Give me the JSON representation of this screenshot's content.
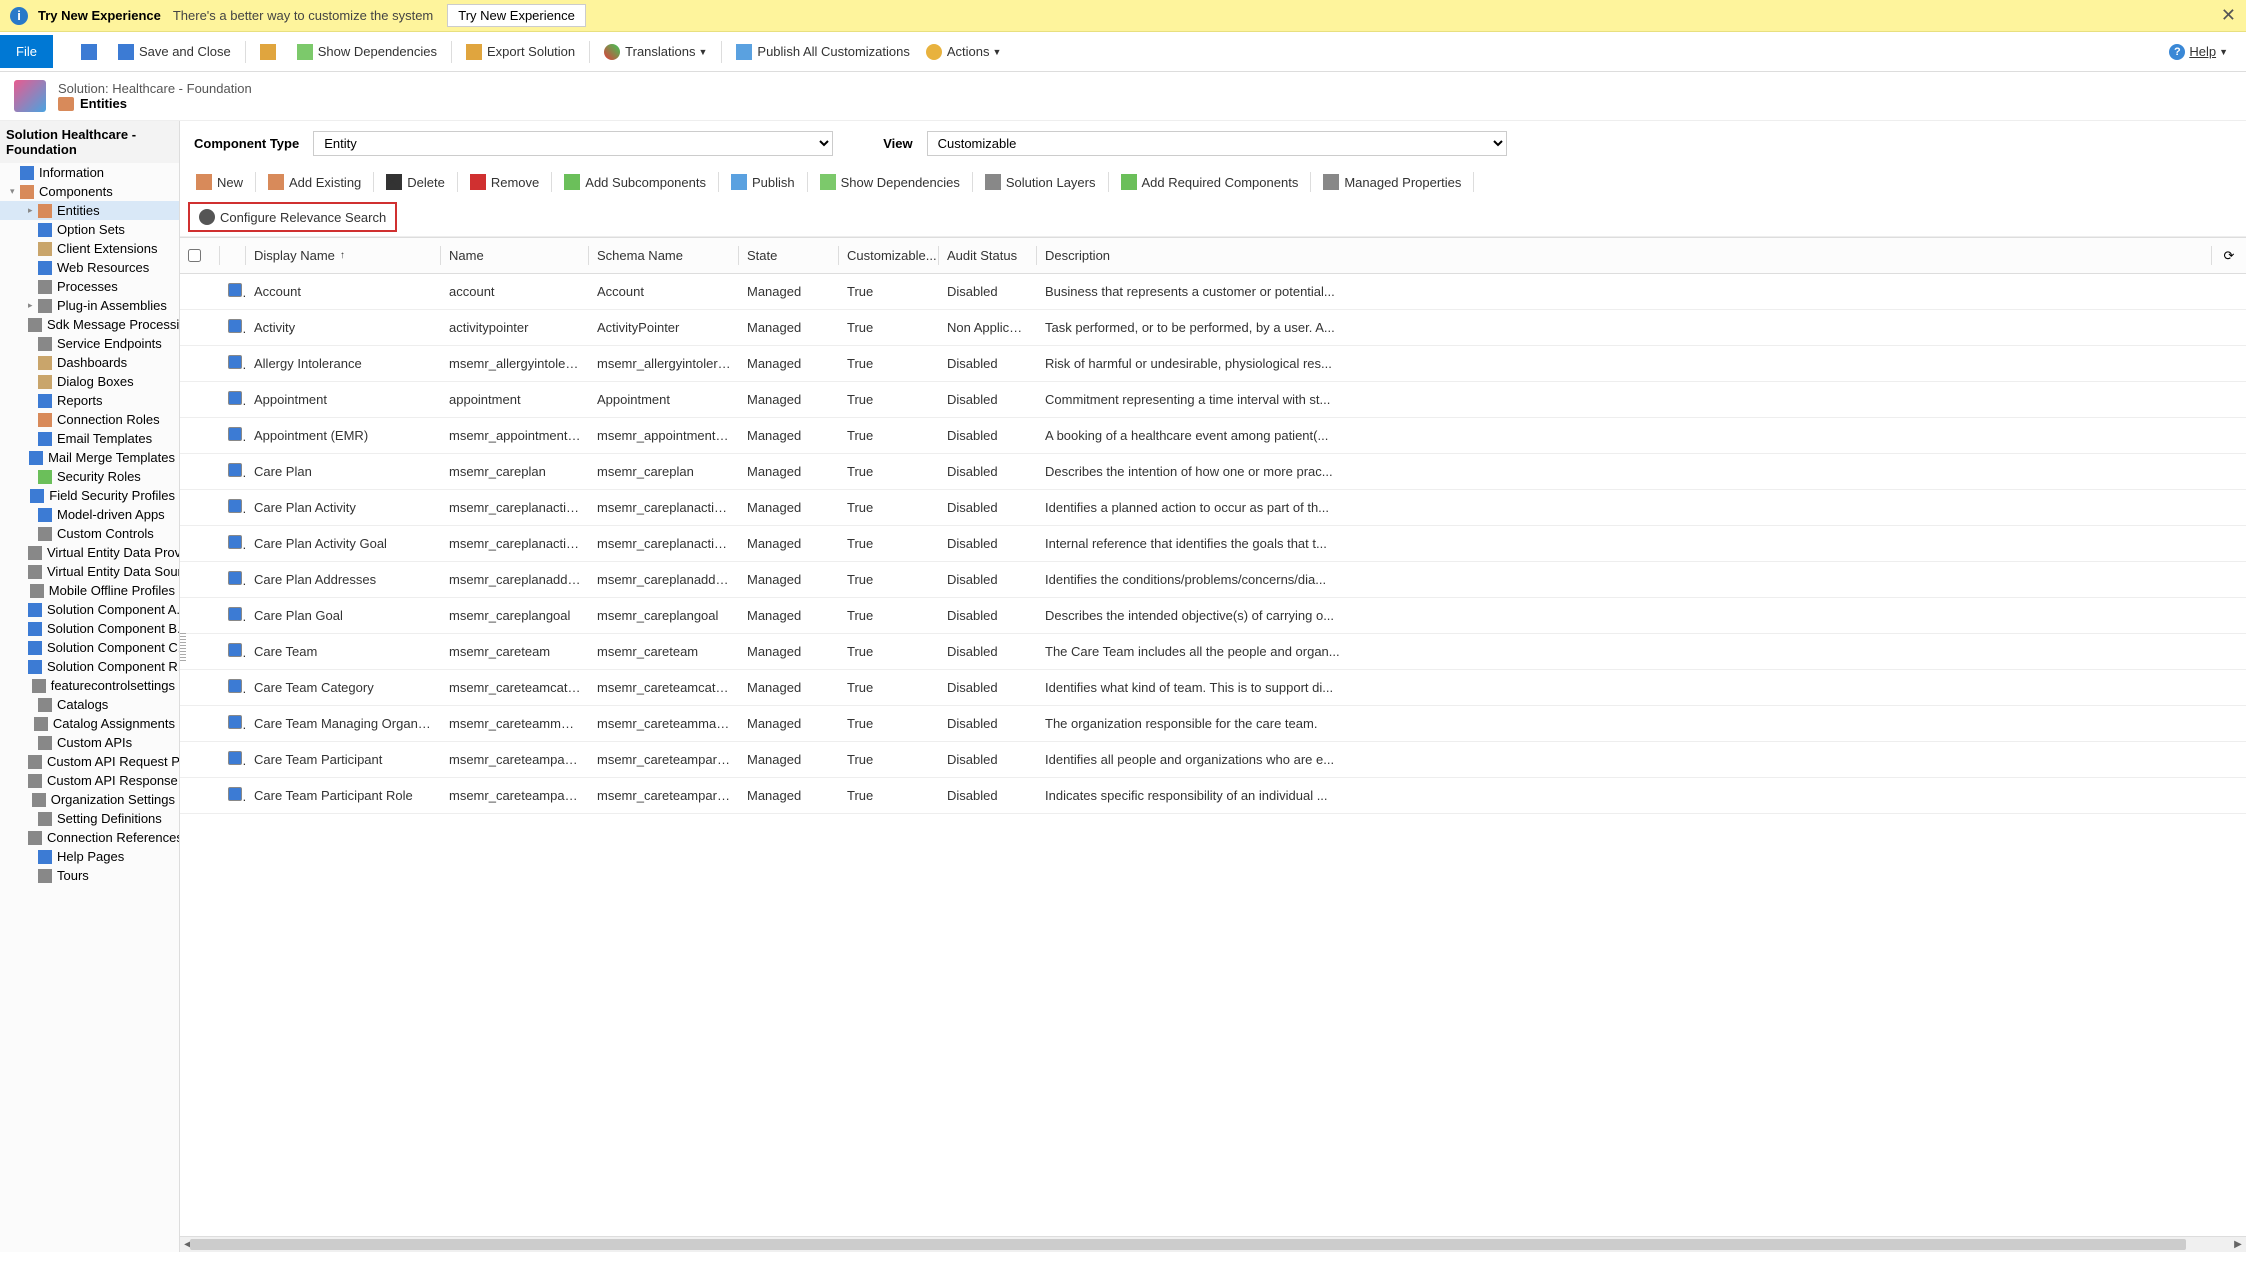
{
  "banner": {
    "title": "Try New Experience",
    "subtitle": "There's a better way to customize the system",
    "button": "Try New Experience"
  },
  "ribbon": {
    "file": "File",
    "save_close": "Save and Close",
    "show_deps": "Show Dependencies",
    "export": "Export Solution",
    "translations": "Translations",
    "publish_all": "Publish All Customizations",
    "actions": "Actions",
    "help": "Help"
  },
  "header": {
    "breadcrumb": "Solution: Healthcare - Foundation",
    "title": "Entities"
  },
  "sidebar": {
    "title": "Solution Healthcare - Foundation",
    "items": [
      {
        "label": "Information",
        "cls": "sic-blue",
        "lvl": 1
      },
      {
        "label": "Components",
        "cls": "sic-orange",
        "lvl": 1,
        "tw": "▾"
      },
      {
        "label": "Entities",
        "cls": "sic-orange",
        "lvl": 2,
        "tw": "▸",
        "sel": true
      },
      {
        "label": "Option Sets",
        "cls": "sic-blue",
        "lvl": 2
      },
      {
        "label": "Client Extensions",
        "cls": "sic-tan",
        "lvl": 2
      },
      {
        "label": "Web Resources",
        "cls": "sic-blue",
        "lvl": 2
      },
      {
        "label": "Processes",
        "cls": "sic-gray",
        "lvl": 2
      },
      {
        "label": "Plug-in Assemblies",
        "cls": "sic-gray",
        "lvl": 2,
        "tw": "▸"
      },
      {
        "label": "Sdk Message Processin...",
        "cls": "sic-gray",
        "lvl": 2
      },
      {
        "label": "Service Endpoints",
        "cls": "sic-gray",
        "lvl": 2
      },
      {
        "label": "Dashboards",
        "cls": "sic-tan",
        "lvl": 2
      },
      {
        "label": "Dialog Boxes",
        "cls": "sic-tan",
        "lvl": 2
      },
      {
        "label": "Reports",
        "cls": "sic-blue",
        "lvl": 2
      },
      {
        "label": "Connection Roles",
        "cls": "sic-orange",
        "lvl": 2
      },
      {
        "label": "Email Templates",
        "cls": "sic-blue",
        "lvl": 2
      },
      {
        "label": "Mail Merge Templates",
        "cls": "sic-blue",
        "lvl": 2
      },
      {
        "label": "Security Roles",
        "cls": "sic-green",
        "lvl": 2
      },
      {
        "label": "Field Security Profiles",
        "cls": "sic-blue",
        "lvl": 2
      },
      {
        "label": "Model-driven Apps",
        "cls": "sic-blue",
        "lvl": 2
      },
      {
        "label": "Custom Controls",
        "cls": "sic-gray",
        "lvl": 2
      },
      {
        "label": "Virtual Entity Data Prov...",
        "cls": "sic-gray",
        "lvl": 2
      },
      {
        "label": "Virtual Entity Data Sour...",
        "cls": "sic-gray",
        "lvl": 2
      },
      {
        "label": "Mobile Offline Profiles",
        "cls": "sic-gray",
        "lvl": 2
      },
      {
        "label": "Solution Component A...",
        "cls": "sic-blue",
        "lvl": 2
      },
      {
        "label": "Solution Component B...",
        "cls": "sic-blue",
        "lvl": 2
      },
      {
        "label": "Solution Component C...",
        "cls": "sic-blue",
        "lvl": 2
      },
      {
        "label": "Solution Component R...",
        "cls": "sic-blue",
        "lvl": 2
      },
      {
        "label": "featurecontrolsettings",
        "cls": "sic-gray",
        "lvl": 2
      },
      {
        "label": "Catalogs",
        "cls": "sic-gray",
        "lvl": 2
      },
      {
        "label": "Catalog Assignments",
        "cls": "sic-gray",
        "lvl": 2
      },
      {
        "label": "Custom APIs",
        "cls": "sic-gray",
        "lvl": 2
      },
      {
        "label": "Custom API Request Pa...",
        "cls": "sic-gray",
        "lvl": 2
      },
      {
        "label": "Custom API Response ...",
        "cls": "sic-gray",
        "lvl": 2
      },
      {
        "label": "Organization Settings",
        "cls": "sic-gray",
        "lvl": 2
      },
      {
        "label": "Setting Definitions",
        "cls": "sic-gray",
        "lvl": 2
      },
      {
        "label": "Connection References",
        "cls": "sic-gray",
        "lvl": 2
      },
      {
        "label": "Help Pages",
        "cls": "sic-blue",
        "lvl": 2
      },
      {
        "label": "Tours",
        "cls": "sic-gray",
        "lvl": 2
      }
    ]
  },
  "filters": {
    "comp_type_label": "Component Type",
    "comp_type_value": "Entity",
    "view_label": "View",
    "view_value": "Customizable"
  },
  "toolbar2": {
    "new_": "New",
    "add_existing": "Add Existing",
    "delete_": "Delete",
    "remove": "Remove",
    "add_sub": "Add Subcomponents",
    "publish": "Publish",
    "show_deps": "Show Dependencies",
    "layers": "Solution Layers",
    "add_req": "Add Required Components",
    "mprops": "Managed Properties",
    "config_search": "Configure Relevance Search"
  },
  "grid": {
    "headers": {
      "disp": "Display Name",
      "name": "Name",
      "schema": "Schema Name",
      "state": "State",
      "cust": "Customizable...",
      "audit": "Audit Status",
      "desc": "Description"
    },
    "rows": [
      {
        "disp": "Account",
        "name": "account",
        "schema": "Account",
        "state": "Managed",
        "cust": "True",
        "audit": "Disabled",
        "desc": "Business that represents a customer or potential..."
      },
      {
        "disp": "Activity",
        "name": "activitypointer",
        "schema": "ActivityPointer",
        "state": "Managed",
        "cust": "True",
        "audit": "Non Applicable",
        "desc": "Task performed, or to be performed, by a user. A..."
      },
      {
        "disp": "Allergy Intolerance",
        "name": "msemr_allergyintolera...",
        "schema": "msemr_allergyintolera...",
        "state": "Managed",
        "cust": "True",
        "audit": "Disabled",
        "desc": "Risk of harmful or undesirable, physiological res..."
      },
      {
        "disp": "Appointment",
        "name": "appointment",
        "schema": "Appointment",
        "state": "Managed",
        "cust": "True",
        "audit": "Disabled",
        "desc": "Commitment representing a time interval with st..."
      },
      {
        "disp": "Appointment (EMR)",
        "name": "msemr_appointmente...",
        "schema": "msemr_appointmente...",
        "state": "Managed",
        "cust": "True",
        "audit": "Disabled",
        "desc": "A booking of a healthcare event among patient(..."
      },
      {
        "disp": "Care Plan",
        "name": "msemr_careplan",
        "schema": "msemr_careplan",
        "state": "Managed",
        "cust": "True",
        "audit": "Disabled",
        "desc": "Describes the intention of how one or more prac..."
      },
      {
        "disp": "Care Plan Activity",
        "name": "msemr_careplanactivity",
        "schema": "msemr_careplanactivity",
        "state": "Managed",
        "cust": "True",
        "audit": "Disabled",
        "desc": "Identifies a planned action to occur as part of th..."
      },
      {
        "disp": "Care Plan Activity Goal",
        "name": "msemr_careplanactivit...",
        "schema": "msemr_careplanactivit...",
        "state": "Managed",
        "cust": "True",
        "audit": "Disabled",
        "desc": "Internal reference that identifies the goals that t..."
      },
      {
        "disp": "Care Plan Addresses",
        "name": "msemr_careplanaddre...",
        "schema": "msemr_careplanaddre...",
        "state": "Managed",
        "cust": "True",
        "audit": "Disabled",
        "desc": "Identifies the conditions/problems/concerns/dia..."
      },
      {
        "disp": "Care Plan Goal",
        "name": "msemr_careplangoal",
        "schema": "msemr_careplangoal",
        "state": "Managed",
        "cust": "True",
        "audit": "Disabled",
        "desc": "Describes the intended objective(s) of carrying o..."
      },
      {
        "disp": "Care Team",
        "name": "msemr_careteam",
        "schema": "msemr_careteam",
        "state": "Managed",
        "cust": "True",
        "audit": "Disabled",
        "desc": "The Care Team includes all the people and organ..."
      },
      {
        "disp": "Care Team Category",
        "name": "msemr_careteamcateg...",
        "schema": "msemr_careteamcateg...",
        "state": "Managed",
        "cust": "True",
        "audit": "Disabled",
        "desc": "Identifies what kind of team. This is to support di..."
      },
      {
        "disp": "Care Team Managing Organiza...",
        "name": "msemr_careteammana...",
        "schema": "msemr_careteammana...",
        "state": "Managed",
        "cust": "True",
        "audit": "Disabled",
        "desc": "The organization responsible for the care team."
      },
      {
        "disp": "Care Team Participant",
        "name": "msemr_careteamparti...",
        "schema": "msemr_careteamparti...",
        "state": "Managed",
        "cust": "True",
        "audit": "Disabled",
        "desc": "Identifies all people and organizations who are e..."
      },
      {
        "disp": "Care Team Participant Role",
        "name": "msemr_careteamparti...",
        "schema": "msemr_careteamparti...",
        "state": "Managed",
        "cust": "True",
        "audit": "Disabled",
        "desc": "Indicates specific responsibility of an individual ..."
      }
    ]
  }
}
